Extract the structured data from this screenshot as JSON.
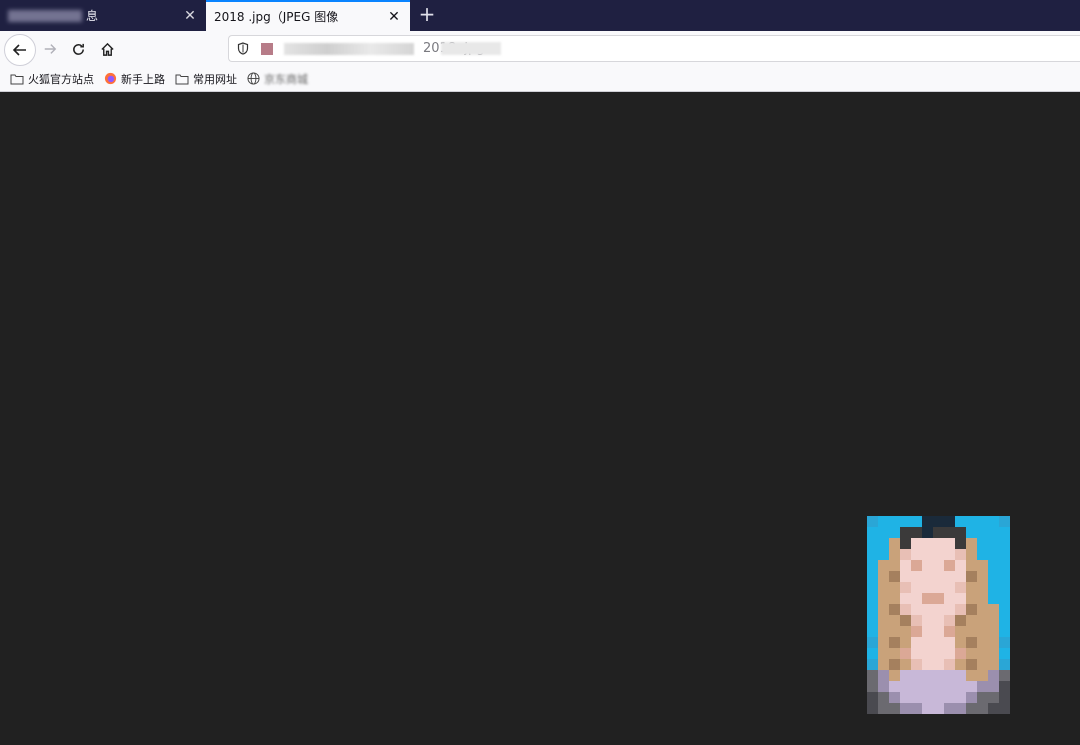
{
  "tabs": [
    {
      "title": "息",
      "state": "inactive"
    },
    {
      "title": "2018 .jpg（JPEG 图像",
      "state": "active"
    }
  ],
  "toolbar": {
    "url": "2018 .jpg"
  },
  "bookmarks": [
    {
      "label": "火狐官方站点",
      "icon": "folder-icon"
    },
    {
      "label": "新手上路",
      "icon": "firefox-icon"
    },
    {
      "label": "常用网址",
      "icon": "folder-icon"
    },
    {
      "label": "京东商城",
      "icon": "globe-icon"
    }
  ],
  "colors": {
    "tabstrip": "#1f2041",
    "accent": "#0a84ff",
    "content_bg": "#212121",
    "photo_bg": "#1fb3e5"
  },
  "content": {
    "image_alt": "JPEG 图像"
  }
}
